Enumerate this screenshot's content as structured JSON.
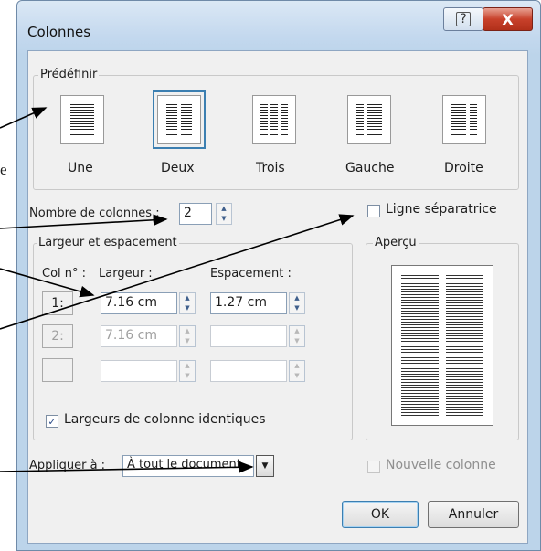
{
  "window": {
    "title": "Colonnes",
    "help_glyph": "?",
    "close_glyph": "X"
  },
  "side_letter": "e",
  "preset": {
    "group_label": "Prédéfinir",
    "options": [
      {
        "label": "Une",
        "selected": false
      },
      {
        "label": "Deux",
        "selected": true
      },
      {
        "label": "Trois",
        "selected": false
      },
      {
        "label": "Gauche",
        "selected": false
      },
      {
        "label": "Droite",
        "selected": false
      }
    ]
  },
  "nombre_colonnes": {
    "label": "Nombre de colonnes :",
    "value": "2"
  },
  "ligne_separatrice": {
    "label": "Ligne séparatrice",
    "checked": false
  },
  "largeur_group": {
    "label": "Largeur et espacement",
    "col_header": "Col n° :",
    "largeur_header": "Largeur :",
    "espacement_header": "Espacement :",
    "rows": [
      {
        "num": "1:",
        "largeur": "7.16 cm",
        "espacement": "1.27 cm",
        "enabled": true
      },
      {
        "num": "2:",
        "largeur": "7.16 cm",
        "espacement": "",
        "enabled": false
      },
      {
        "num": "",
        "largeur": "",
        "espacement": "",
        "enabled": false
      }
    ],
    "identiques_label": "Largeurs de colonne identiques",
    "identiques_checked": true
  },
  "apercu": {
    "label": "Aperçu",
    "columns": 2
  },
  "appliquer": {
    "label": "Appliquer à :",
    "value": "À tout le document"
  },
  "nouvelle_colonne": {
    "label": "Nouvelle colonne",
    "checked": false
  },
  "buttons": {
    "ok": "OK",
    "cancel": "Annuler"
  },
  "colors": {
    "accent": "#3c7fb1",
    "close": "#c8412b"
  }
}
